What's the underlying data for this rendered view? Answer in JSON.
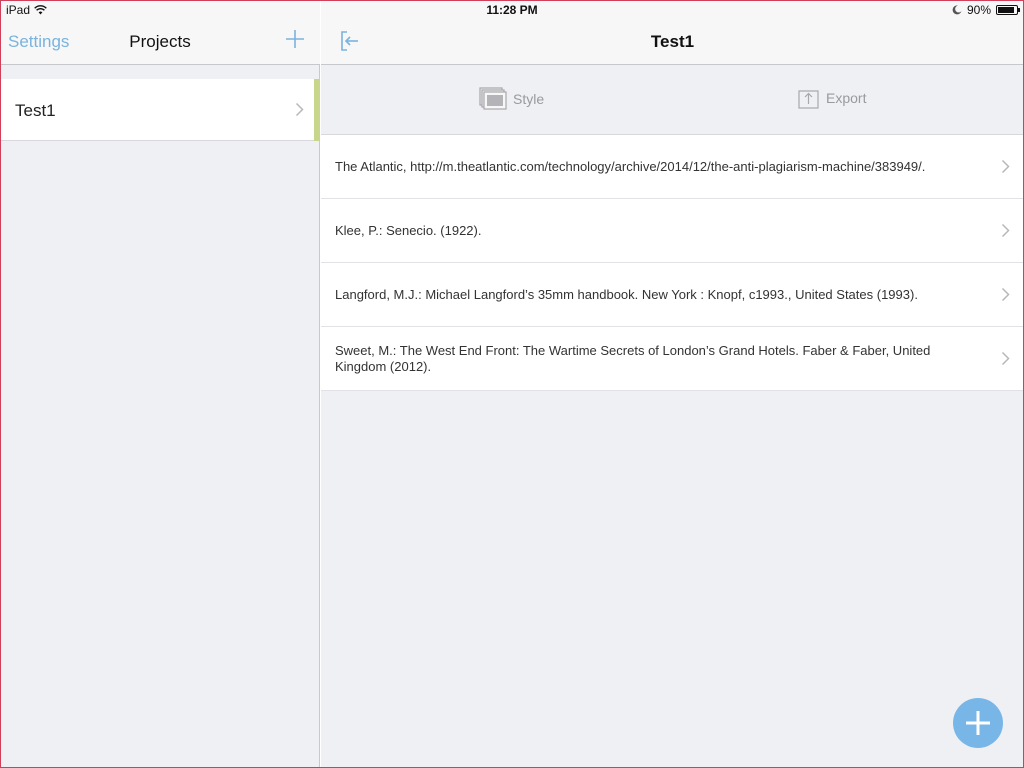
{
  "status_bar": {
    "device": "iPad",
    "time": "11:28 PM",
    "battery": "90%",
    "battery_level": 0.9,
    "icons": [
      "wifi-icon",
      "moon-icon",
      "battery-icon"
    ]
  },
  "left_pane": {
    "settings_label": "Settings",
    "title": "Projects",
    "add_icon": "plus-icon",
    "projects": [
      {
        "label": "Test1"
      }
    ]
  },
  "right_pane": {
    "title": "Test1",
    "back_icon": "exit-icon",
    "toolbar": {
      "style_label": "Style",
      "export_label": "Export"
    },
    "references": [
      {
        "text": "The Atlantic, http://m.theatlantic.com/technology/archive/2014/12/the-anti-plagiarism-machine/383949/."
      },
      {
        "text": "Klee, P.: Senecio. (1922)."
      },
      {
        "text": "Langford, M.J.: Michael Langford’s 35mm handbook. New York : Knopf, c1993., United States (1993)."
      },
      {
        "text": "Sweet, M.: The West End Front: The Wartime Secrets of London’s Grand Hotels. Faber & Faber, United Kingdom (2012)."
      }
    ]
  },
  "colors": {
    "accent_blue": "#7ab3de",
    "fab_blue": "#79b6e8",
    "selection_green": "#c7d68a",
    "pane_background": "#eff0f4"
  }
}
